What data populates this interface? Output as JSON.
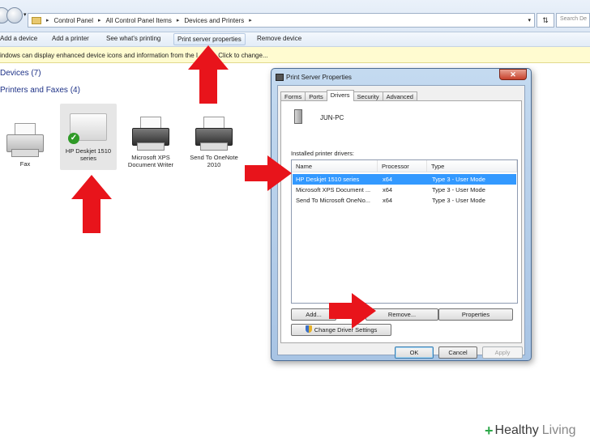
{
  "address_bar": {
    "breadcrumbs": [
      "Control Panel",
      "All Control Panel Items",
      "Devices and Printers"
    ],
    "search_placeholder": "Search De",
    "refresh_glyph": "⇅"
  },
  "command_bar": {
    "items": [
      "Add a device",
      "Add a printer",
      "See what's printing",
      "Print server properties",
      "Remove device"
    ]
  },
  "info_bar": {
    "text_left": "indows can display enhanced device icons and information from the I",
    "text_right": "et. Click to change..."
  },
  "devices_section": {
    "label": "Devices (7)"
  },
  "printers_section": {
    "label": "Printers and Faxes (4)",
    "items": [
      {
        "label": "Fax"
      },
      {
        "label": "HP Deskjet 1510 series",
        "default": true
      },
      {
        "label": "Microsoft XPS Document Writer"
      },
      {
        "label": "Send To OneNote 2010"
      }
    ]
  },
  "dialog": {
    "title": "Print Server Properties",
    "close_glyph": "✕",
    "tabs": [
      "Forms",
      "Ports",
      "Drivers",
      "Security",
      "Advanced"
    ],
    "active_tab": "Drivers",
    "server_name": "JUN-PC",
    "installed_label": "Installed printer drivers:",
    "columns": [
      "Name",
      "Processor",
      "Type"
    ],
    "drivers": [
      {
        "name": "HP Deskjet 1510 series",
        "processor": "x64",
        "type": "Type 3 - User Mode",
        "selected": true
      },
      {
        "name": "Microsoft XPS Document ...",
        "processor": "x64",
        "type": "Type 3 - User Mode"
      },
      {
        "name": "Send To Microsoft OneNo...",
        "processor": "x64",
        "type": "Type 3 - User Mode"
      }
    ],
    "buttons": {
      "add": "Add...",
      "remove": "Remove...",
      "properties": "Properties",
      "change_settings": "Change Driver Settings",
      "ok": "OK",
      "cancel": "Cancel",
      "apply": "Apply"
    }
  },
  "colors": {
    "arrow": "#e8141b",
    "selection": "#3399ff",
    "heading": "#1e3287",
    "infobar": "#fffbd0"
  },
  "watermark": {
    "part1": "Healthy",
    "part2": "Living"
  }
}
